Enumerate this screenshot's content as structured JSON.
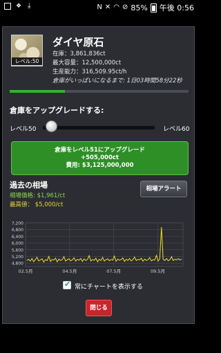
{
  "status_bar": {
    "battery_text": "85%",
    "time": "午後 0:56",
    "icons": [
      "image-icon",
      "dropbox-icon",
      "download-icon",
      "nfc-icon",
      "mute-icon",
      "wifi-icon",
      "blocked-icon",
      "battery-icon"
    ]
  },
  "item": {
    "title": "ダイヤ原石",
    "level_badge": "レベル:50",
    "stock": "在庫：3,861,836ct",
    "capacity": "最大容量：12,500,000ct",
    "production": "生産能力：316,509.95ct/h",
    "full_in": "倉庫がいっぱいになるまで: 1日03時間58分22秒",
    "progress": 0.31
  },
  "upgrade": {
    "heading": "倉庫をアップグレードする:",
    "level_from": "レベル50",
    "level_to": "レベル60",
    "slider_value": 50,
    "button_line1": "倉庫をレベル51にアップグレード",
    "button_line2": "+505,000ct",
    "button_line3": "費用: $3,125,000,000"
  },
  "history": {
    "heading": "過去の相場",
    "market_price": "相場価格: $1,961/ct",
    "highest_price": "最高値： $5,000/ct",
    "alert_button": "相場アラート",
    "checkbox_label": "常にチャートを表示する",
    "checkbox_checked": true,
    "close_button": "閉じる"
  },
  "colors": {
    "accent_green": "#35b233",
    "line_yellow": "#f3dc2c",
    "close_red": "#c8262b"
  },
  "chart_data": {
    "type": "line",
    "title": "",
    "xlabel": "",
    "ylabel": "",
    "ylim": [
      4600,
      7200
    ],
    "yticks": [
      4800,
      5200,
      5600,
      6000,
      6400,
      6800,
      7200
    ],
    "ytick_labels": [
      "4,800",
      "5,200",
      "5,600",
      "6,000",
      "6,400",
      "6,800",
      "7,200"
    ],
    "xtick_labels": [
      "02.5月",
      "04.5月",
      "07.5月",
      "09.5月"
    ],
    "grid": true,
    "series": [
      {
        "values": [
          4960,
          5030,
          4920,
          5080,
          4890,
          5010,
          5150,
          4930,
          4990,
          5060,
          4870,
          5010,
          4950,
          5200,
          4900,
          5020,
          4980,
          5100,
          4880,
          5040,
          4960,
          5010,
          5180,
          4920,
          5000,
          5060,
          4940,
          4990,
          5120,
          4910,
          5030,
          4970,
          5080,
          4900,
          5050,
          4960,
          5020,
          5250,
          4930,
          5010,
          4970,
          5090,
          4880,
          5030,
          4950,
          5140,
          4920,
          5000,
          5060,
          4940,
          5020,
          4980,
          5220,
          4910,
          5040,
          4970,
          5010,
          5110,
          4900,
          5030,
          4960,
          5070,
          4930,
          5010,
          5160,
          4950,
          5020,
          4990,
          5090,
          4910,
          5040,
          4960,
          5000,
          5130,
          4930,
          5010,
          4980,
          5260,
          4920,
          5050,
          6950,
          5020,
          4960,
          5080,
          4940,
          5010,
          5180,
          4950,
          5030,
          4990,
          5070,
          4980,
          5050
        ]
      }
    ]
  }
}
